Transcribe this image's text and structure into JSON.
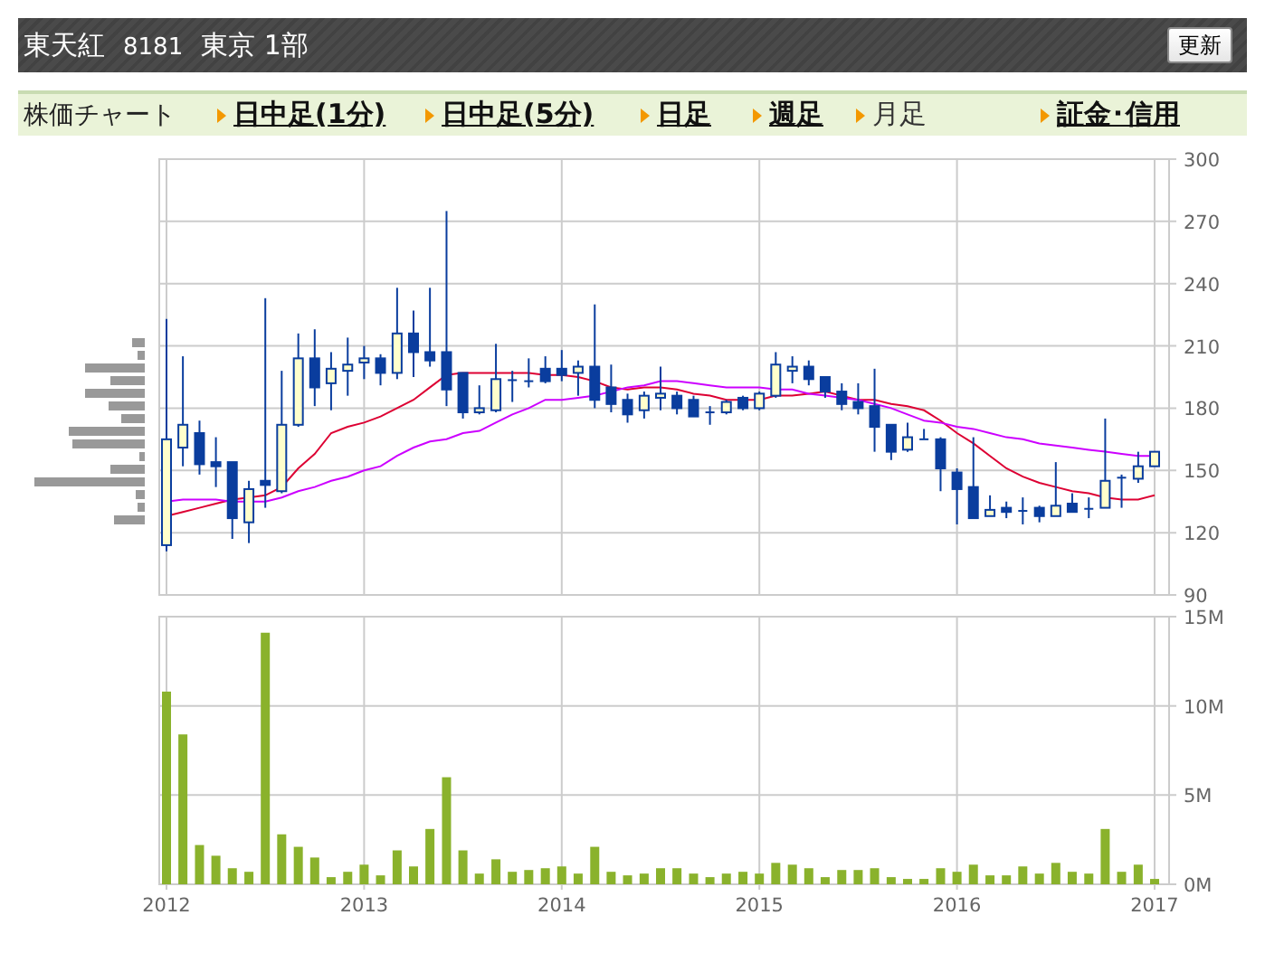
{
  "header": {
    "company": "東天紅",
    "code": "8181",
    "market": "東京 1部",
    "refresh_button": "更新"
  },
  "nav": {
    "label": "株価チャート",
    "items": [
      {
        "label": "日中足(1分)",
        "selected": false
      },
      {
        "label": "日中足(5分)",
        "selected": false
      },
      {
        "label": "日足",
        "selected": false
      },
      {
        "label": "週足",
        "selected": false
      },
      {
        "label": "月足",
        "selected": true
      },
      {
        "label": "証金･信用",
        "selected": false
      }
    ]
  },
  "price_chart": {
    "chart_data": {
      "type": "candlestick",
      "grid": true,
      "xlim": [
        2012,
        2017
      ],
      "ylim": [
        90,
        300
      ],
      "yticks": [
        90,
        120,
        150,
        180,
        210,
        240,
        270,
        300
      ],
      "x": [
        2012,
        2012.083,
        2012.167,
        2012.25,
        2012.333,
        2012.417,
        2012.5,
        2012.583,
        2012.667,
        2012.75,
        2012.833,
        2012.917,
        2013,
        2013.083,
        2013.167,
        2013.25,
        2013.333,
        2013.417,
        2013.5,
        2013.583,
        2013.667,
        2013.75,
        2013.833,
        2013.917,
        2014,
        2014.083,
        2014.167,
        2014.25,
        2014.333,
        2014.417,
        2014.5,
        2014.583,
        2014.667,
        2014.75,
        2014.833,
        2014.917,
        2015,
        2015.083,
        2015.167,
        2015.25,
        2015.333,
        2015.417,
        2015.5,
        2015.583,
        2015.667,
        2015.75,
        2015.833,
        2015.917,
        2016,
        2016.083,
        2016.167,
        2016.25,
        2016.333,
        2016.417,
        2016.5,
        2016.583,
        2016.667,
        2016.75,
        2016.833,
        2016.917,
        2017
      ],
      "ohlc": [
        [
          114,
          223,
          111,
          165
        ],
        [
          161,
          205,
          152,
          172
        ],
        [
          168,
          174,
          148,
          153
        ],
        [
          154,
          166,
          142,
          152
        ],
        [
          154,
          154,
          117,
          127
        ],
        [
          125,
          145,
          115,
          141
        ],
        [
          145,
          233,
          132,
          143
        ],
        [
          140,
          198,
          139,
          172
        ],
        [
          172,
          216,
          171,
          204
        ],
        [
          204,
          218,
          181,
          190
        ],
        [
          192,
          207,
          179,
          199
        ],
        [
          198,
          214,
          186,
          201
        ],
        [
          202,
          210,
          194,
          204
        ],
        [
          204,
          206,
          191,
          197
        ],
        [
          197,
          238,
          194,
          216
        ],
        [
          216,
          227,
          195,
          207
        ],
        [
          207,
          238,
          200,
          203
        ],
        [
          207,
          275,
          181,
          189
        ],
        [
          197,
          197,
          175,
          178
        ],
        [
          178,
          191,
          177,
          180
        ],
        [
          179,
          211,
          178,
          194
        ],
        [
          194,
          198,
          183,
          193
        ],
        [
          193,
          204,
          190,
          193
        ],
        [
          199,
          205,
          192,
          193
        ],
        [
          199,
          208,
          193,
          196
        ],
        [
          197,
          203,
          186,
          200
        ],
        [
          200,
          230,
          180,
          184
        ],
        [
          190,
          201,
          178,
          182
        ],
        [
          184,
          187,
          173,
          177
        ],
        [
          179,
          188,
          175,
          186
        ],
        [
          185,
          200,
          179,
          187
        ],
        [
          186,
          188,
          177,
          180
        ],
        [
          184,
          186,
          176,
          176
        ],
        [
          178,
          181,
          172,
          178
        ],
        [
          178,
          184,
          177,
          183
        ],
        [
          185,
          186,
          179,
          180
        ],
        [
          180,
          188,
          179,
          187
        ],
        [
          186,
          207,
          185,
          201
        ],
        [
          198,
          205,
          192,
          200
        ],
        [
          200,
          203,
          191,
          194
        ],
        [
          195,
          195,
          185,
          188
        ],
        [
          188,
          192,
          179,
          182
        ],
        [
          183,
          192,
          177,
          180
        ],
        [
          181,
          199,
          159,
          171
        ],
        [
          172,
          172,
          155,
          159
        ],
        [
          160,
          173,
          159,
          166
        ],
        [
          165,
          170,
          165,
          165
        ],
        [
          165,
          166,
          140,
          151
        ],
        [
          149,
          151,
          124,
          141
        ],
        [
          142,
          166,
          127,
          127
        ],
        [
          128,
          138,
          128,
          131
        ],
        [
          132,
          135,
          127,
          130
        ],
        [
          130,
          137,
          124,
          131
        ],
        [
          132,
          133,
          125,
          128
        ],
        [
          128,
          154,
          128,
          133
        ],
        [
          134,
          139,
          130,
          130
        ],
        [
          131,
          137,
          127,
          132
        ],
        [
          132,
          175,
          132,
          145
        ],
        [
          146,
          148,
          132,
          147
        ],
        [
          146,
          159,
          144,
          152
        ],
        [
          152,
          159,
          152,
          159
        ]
      ],
      "series": [
        {
          "type": "line",
          "color": "#dd0033",
          "values": [
            128,
            130,
            132,
            134,
            136,
            137,
            138,
            142,
            151,
            158,
            168,
            171,
            173,
            176,
            180,
            184,
            190,
            196,
            197,
            197,
            197,
            197,
            197,
            196,
            196,
            195,
            193,
            190,
            189,
            190,
            190,
            189,
            187,
            186,
            184,
            184,
            184,
            186,
            186,
            187,
            188,
            186,
            184,
            184,
            182,
            181,
            179,
            174,
            168,
            163,
            157,
            151,
            147,
            144,
            142,
            140,
            139,
            137,
            136,
            136,
            138
          ]
        },
        {
          "type": "line",
          "color": "#cc00ff",
          "values": [
            135,
            136,
            136,
            136,
            135,
            135,
            135,
            137,
            140,
            142,
            145,
            147,
            150,
            152,
            157,
            161,
            164,
            165,
            168,
            169,
            173,
            177,
            180,
            184,
            184,
            185,
            186,
            188,
            190,
            191,
            193,
            193,
            192,
            191,
            190,
            190,
            190,
            189,
            189,
            187,
            186,
            185,
            184,
            182,
            180,
            177,
            174,
            173,
            171,
            170,
            168,
            166,
            165,
            163,
            162,
            161,
            160,
            159,
            158,
            157,
            157
          ]
        }
      ]
    }
  },
  "volume_chart": {
    "chart_data": {
      "type": "bar",
      "grid": true,
      "xlim": [
        2012,
        2017
      ],
      "ylim": [
        0,
        15
      ],
      "xticks": [
        2012,
        2013,
        2014,
        2015,
        2016,
        2017
      ],
      "yticks": [
        {
          "value": 0,
          "label": "0M"
        },
        {
          "value": 5,
          "label": "5M"
        },
        {
          "value": 10,
          "label": "10M"
        },
        {
          "value": 15,
          "label": "15M"
        }
      ],
      "x": [
        2012,
        2012.083,
        2012.167,
        2012.25,
        2012.333,
        2012.417,
        2012.5,
        2012.583,
        2012.667,
        2012.75,
        2012.833,
        2012.917,
        2013,
        2013.083,
        2013.167,
        2013.25,
        2013.333,
        2013.417,
        2013.5,
        2013.583,
        2013.667,
        2013.75,
        2013.833,
        2013.917,
        2014,
        2014.083,
        2014.167,
        2014.25,
        2014.333,
        2014.417,
        2014.5,
        2014.583,
        2014.667,
        2014.75,
        2014.833,
        2014.917,
        2015,
        2015.083,
        2015.167,
        2015.25,
        2015.333,
        2015.417,
        2015.5,
        2015.583,
        2015.667,
        2015.75,
        2015.833,
        2015.917,
        2016,
        2016.083,
        2016.167,
        2016.25,
        2016.333,
        2016.417,
        2016.5,
        2016.583,
        2016.667,
        2016.75,
        2016.833,
        2016.917,
        2017
      ],
      "series": [
        {
          "color": "#8ab22c",
          "values": [
            10.8,
            8.4,
            2.2,
            1.6,
            0.9,
            0.7,
            14.1,
            2.8,
            2.1,
            1.5,
            0.4,
            0.7,
            1.1,
            0.5,
            1.9,
            1,
            3.1,
            6,
            1.9,
            0.6,
            1.4,
            0.7,
            0.8,
            0.9,
            1,
            0.6,
            2.1,
            0.7,
            0.5,
            0.6,
            0.9,
            0.9,
            0.6,
            0.4,
            0.6,
            0.7,
            0.6,
            1.2,
            1.1,
            0.9,
            0.4,
            0.8,
            0.8,
            0.9,
            0.4,
            0.3,
            0.3,
            0.9,
            0.7,
            1.1,
            0.5,
            0.5,
            1,
            0.6,
            1.2,
            0.7,
            0.6,
            3.1,
            0.7,
            1.1,
            0.3
          ]
        }
      ]
    }
  }
}
